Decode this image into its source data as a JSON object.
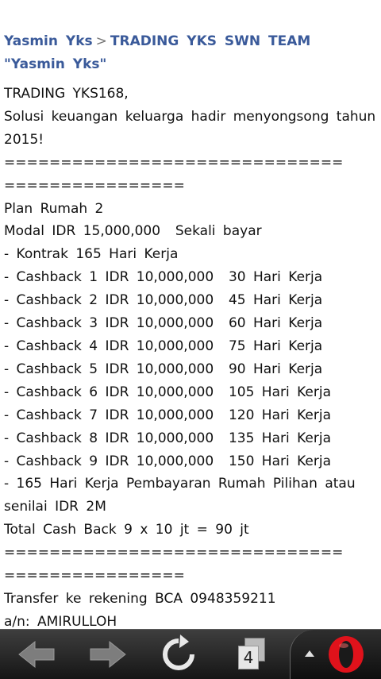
{
  "breadcrumb": {
    "user": "Yasmin Yks",
    "separator": ">",
    "thread": "TRADING YKS SWN TEAM \"Yasmin Yks\""
  },
  "post": {
    "lines": [
      "TRADING YKS168,",
      "Solusi keuangan keluarga hadir menyongsong tahun 2015!",
      "==============================",
      "================",
      "Plan Rumah 2",
      "Modal IDR 15,000,000  Sekali bayar",
      "- Kontrak 165 Hari Kerja",
      "- Cashback 1 IDR 10,000,000  30 Hari Kerja",
      "- Cashback 2 IDR 10,000,000  45 Hari Kerja",
      "- Cashback 3 IDR 10,000,000  60 Hari Kerja",
      "- Cashback 4 IDR 10,000,000  75 Hari Kerja",
      "- Cashback 5 IDR 10,000,000  90 Hari Kerja",
      "- Cashback 6 IDR 10,000,000  105 Hari Kerja",
      "- Cashback 7 IDR 10,000,000  120 Hari Kerja",
      "- Cashback 8 IDR 10,000,000  135 Hari Kerja",
      "- Cashback 9 IDR 10,000,000  150 Hari Kerja",
      "- 165 Hari Kerja Pembayaran Rumah Pilihan atau senilai IDR 2M",
      "Total Cash Back 9 x 10 jt = 90 jt",
      "==============================",
      "================",
      "Transfer ke rekening BCA 0948359211",
      "a/n: AMIRULLOH"
    ]
  },
  "toolbar": {
    "tab_count": "4",
    "icons": [
      "back-arrow-icon",
      "forward-arrow-icon",
      "reload-icon",
      "tabs-icon",
      "chevron-up-icon",
      "opera-logo-icon"
    ],
    "colors": {
      "background": "#1f1f1f",
      "arrow": "#8a8a8a",
      "opera_red": "#e0121b"
    }
  }
}
